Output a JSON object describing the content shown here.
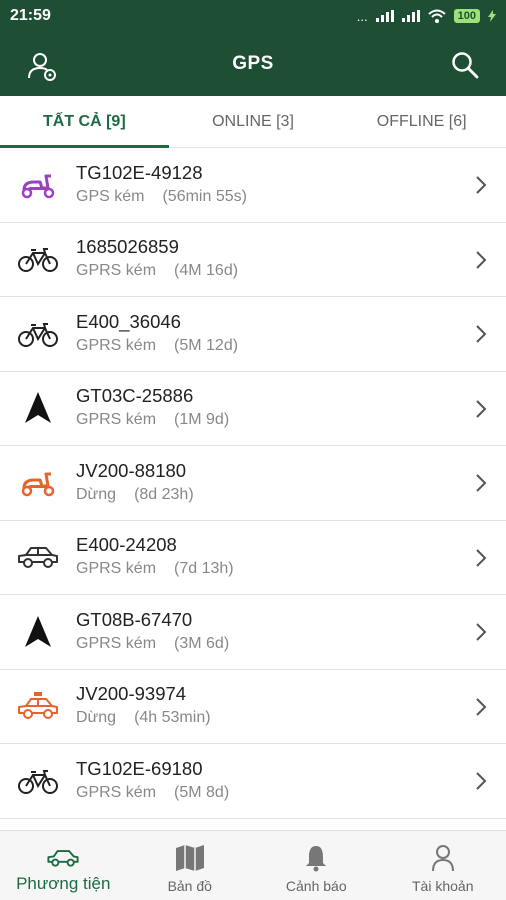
{
  "statusbar": {
    "time": "21:59",
    "signal": "...",
    "battery": "100"
  },
  "appbar": {
    "title": "GPS",
    "left_icon": "user-location-icon",
    "right_icon": "search-icon"
  },
  "tabs": [
    {
      "label": "TẤT CẢ [9]",
      "active": true
    },
    {
      "label": "ONLINE [3]",
      "active": false
    },
    {
      "label": "OFFLINE [6]",
      "active": false
    }
  ],
  "vehicles": [
    {
      "name": "TG102E-49128",
      "status": "GPS kém",
      "duration": "(56min 55s)",
      "icon": "scooter-icon",
      "color": "#9b3fc6"
    },
    {
      "name": "1685026859",
      "status": "GPRS kém",
      "duration": "(4M 16d)",
      "icon": "bicycle-icon",
      "color": "#222222"
    },
    {
      "name": "E400_36046",
      "status": "GPRS kém",
      "duration": "(5M 12d)",
      "icon": "bicycle-icon",
      "color": "#222222"
    },
    {
      "name": "GT03C-25886",
      "status": "GPRS kém",
      "duration": "(1M 9d)",
      "icon": "navigation-arrow-icon",
      "color": "#111111"
    },
    {
      "name": "JV200-88180",
      "status": "Dừng",
      "duration": "(8d 23h)",
      "icon": "scooter-icon",
      "color": "#e8632b"
    },
    {
      "name": "E400-24208",
      "status": "GPRS kém",
      "duration": "(7d 13h)",
      "icon": "car-icon",
      "color": "#333333"
    },
    {
      "name": "GT08B-67470",
      "status": "GPRS kém",
      "duration": "(3M 6d)",
      "icon": "navigation-arrow-icon",
      "color": "#111111"
    },
    {
      "name": "JV200-93974",
      "status": "Dừng",
      "duration": "(4h 53min)",
      "icon": "taxi-icon",
      "color": "#e8632b"
    },
    {
      "name": "TG102E-69180",
      "status": "GPRS kém",
      "duration": "(5M 8d)",
      "icon": "bicycle-icon",
      "color": "#222222"
    }
  ],
  "bottom_nav": [
    {
      "label": "Phương tiện",
      "icon": "car-icon",
      "active": true
    },
    {
      "label": "Bản đồ",
      "icon": "map-icon",
      "active": false
    },
    {
      "label": "Cảnh báo",
      "icon": "bell-icon",
      "active": false
    },
    {
      "label": "Tài khoản",
      "icon": "person-icon",
      "active": false
    }
  ],
  "colors": {
    "primary": "#1e4f35",
    "accent": "#1e6b43"
  }
}
